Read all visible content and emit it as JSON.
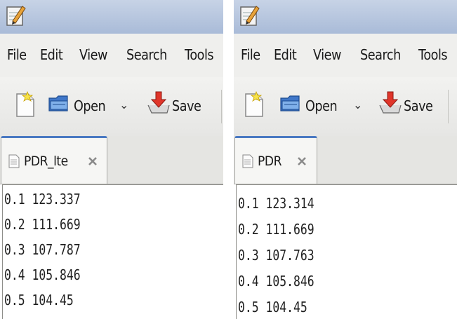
{
  "left_window": {
    "menu": [
      "File",
      "Edit",
      "View",
      "Search",
      "Tools"
    ],
    "toolbar": {
      "open_label": "Open",
      "save_label": "Save"
    },
    "tab": {
      "label": "PDR_lte"
    },
    "lines": [
      "0.1 123.337",
      "0.2 111.669",
      "0.3 107.787",
      "0.4 105.846",
      "0.5 104.45"
    ]
  },
  "right_window": {
    "menu": [
      "File",
      "Edit",
      "View",
      "Search",
      "Tools"
    ],
    "toolbar": {
      "open_label": "Open",
      "save_label": "Save"
    },
    "tab": {
      "label": "PDR"
    },
    "lines": [
      "0.1 123.314",
      "0.2 111.669",
      "0.3 107.763",
      "0.4 105.846",
      "0.5 104.45"
    ]
  },
  "icons": {
    "app": "pencil-notepad-icon",
    "new": "new-document-icon",
    "open": "folder-icon",
    "open_dropdown": "chevron-down-icon",
    "save": "save-download-icon",
    "tab_doc": "text-document-icon",
    "tab_close": "close-icon"
  },
  "colors": {
    "titlebar": "#b3c3dc",
    "tab_accent": "#4a79c2",
    "menubar": "#efefed"
  }
}
